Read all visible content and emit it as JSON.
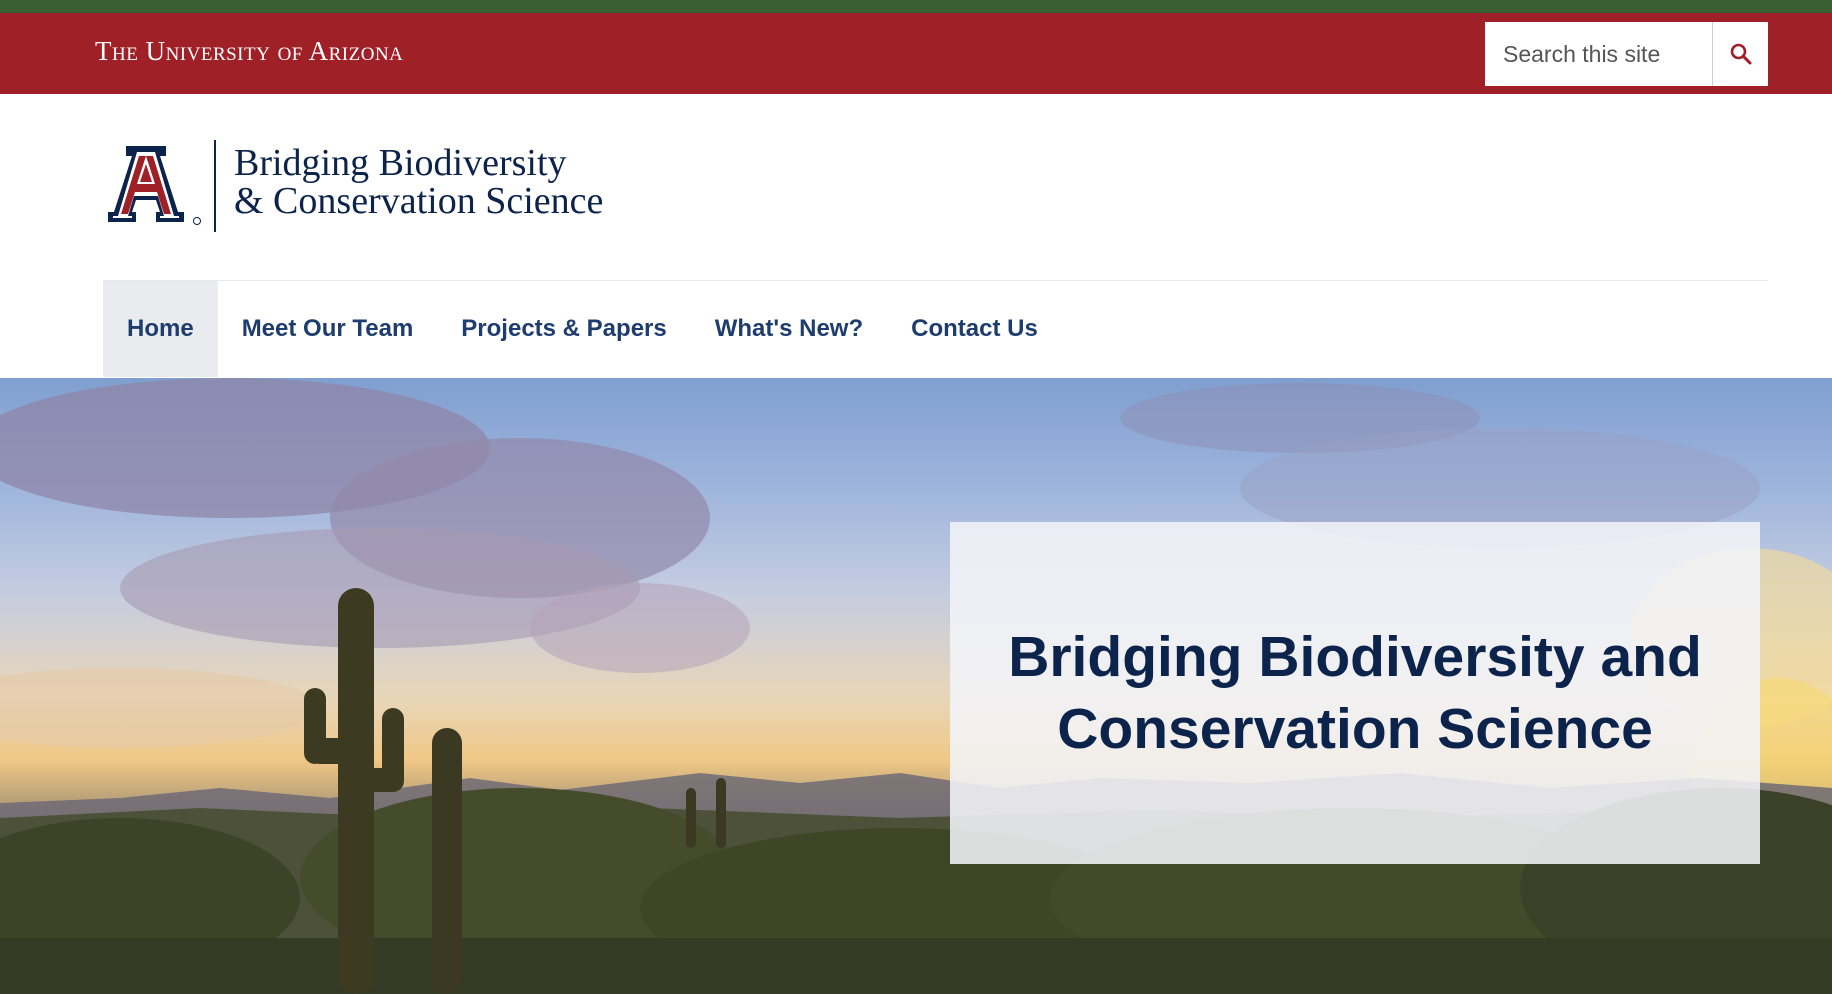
{
  "header": {
    "university_name": "The University of Arizona",
    "search": {
      "placeholder": "Search this site",
      "icon": "search-icon"
    }
  },
  "brand": {
    "line1": "Bridging Biodiversity",
    "line2": "& Conservation Science",
    "logo": "university-block-a-logo"
  },
  "nav": {
    "items": [
      {
        "label": "Home",
        "active": true
      },
      {
        "label": "Meet Our Team",
        "active": false
      },
      {
        "label": "Projects & Papers",
        "active": false
      },
      {
        "label": "What's New?",
        "active": false
      },
      {
        "label": "Contact Us",
        "active": false
      }
    ]
  },
  "hero": {
    "title": "Bridging Biodiversity and Conservation Science"
  },
  "colors": {
    "green_strip": "#3b5e32",
    "arizona_red": "#a02028",
    "arizona_blue": "#0c234b",
    "nav_text": "#1e3d6e",
    "nav_active_bg": "#e9ebef"
  }
}
